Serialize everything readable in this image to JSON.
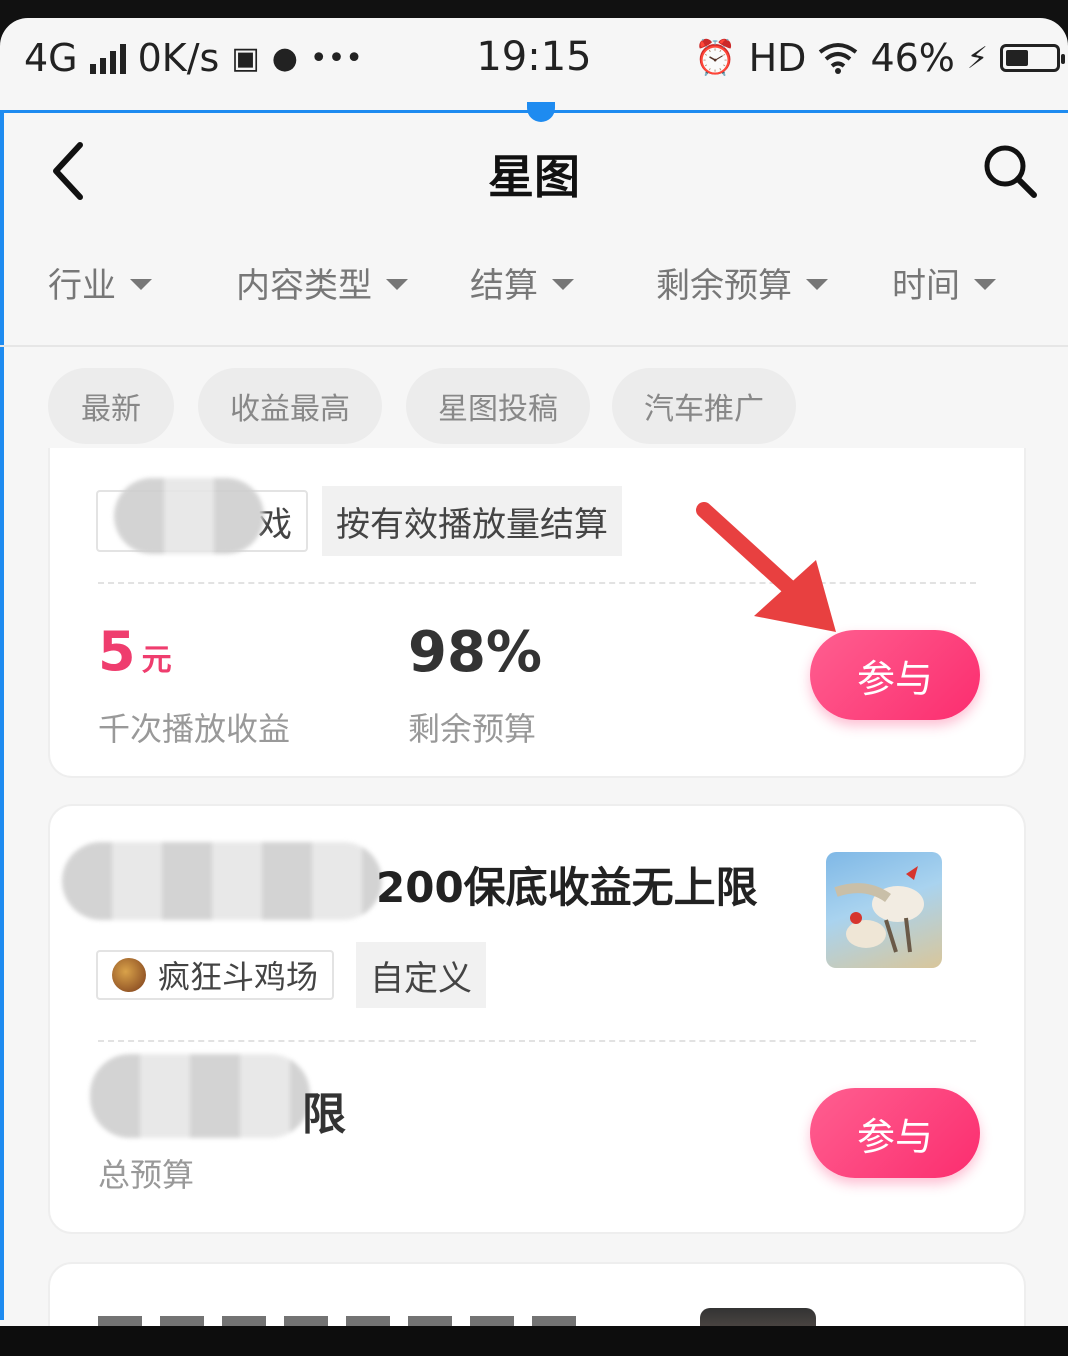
{
  "statusbar": {
    "network": "4G",
    "speed": "0K/s",
    "time": "19:15",
    "hd": "HD",
    "battery_text": "46%",
    "battery_level": 0.46
  },
  "nav": {
    "back_icon": "chevron-left-icon",
    "title": "星图",
    "search_icon": "search-icon"
  },
  "filters": [
    "行业",
    "内容类型",
    "结算",
    "剩余预算",
    "时间"
  ],
  "tags": [
    "最新",
    "收益最高",
    "星图投稿",
    "汽车推广"
  ],
  "card1": {
    "game_tag": "戏",
    "settle_tag": "按有效播放量结算",
    "reward_value": "5",
    "reward_unit": "元",
    "reward_label": "千次播放收益",
    "budget_value": "98%",
    "budget_label": "剩余预算",
    "join_label": "参与"
  },
  "card2": {
    "title_visible": "200保底收益无上限",
    "game_tag": "疯狂斗鸡场",
    "settle_tag": "自定义",
    "budget_visible": "限",
    "budget_label": "总预算",
    "join_label": "参与"
  },
  "colors": {
    "accent_pink": "#fb2d6f",
    "frame_blue": "#1e8bf0",
    "arrow_red": "#e84040"
  }
}
